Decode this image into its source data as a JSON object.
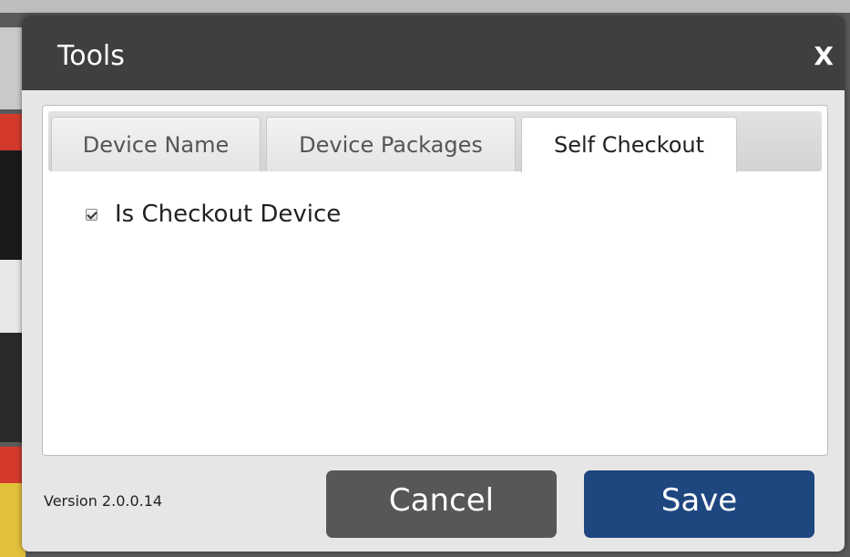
{
  "dialog": {
    "title": "Tools",
    "close_label": "X"
  },
  "tabs": [
    {
      "label": "Device Name",
      "active": false
    },
    {
      "label": "Device Packages",
      "active": false
    },
    {
      "label": "Self Checkout",
      "active": true
    }
  ],
  "self_checkout": {
    "is_checkout_device_label": "Is Checkout Device",
    "is_checkout_device_checked": true
  },
  "footer": {
    "version": "Version 2.0.0.14",
    "cancel_label": "Cancel",
    "save_label": "Save"
  },
  "colors": {
    "titlebar": "#3f3f3f",
    "cancel_button": "#575757",
    "save_button": "#1e4780"
  }
}
